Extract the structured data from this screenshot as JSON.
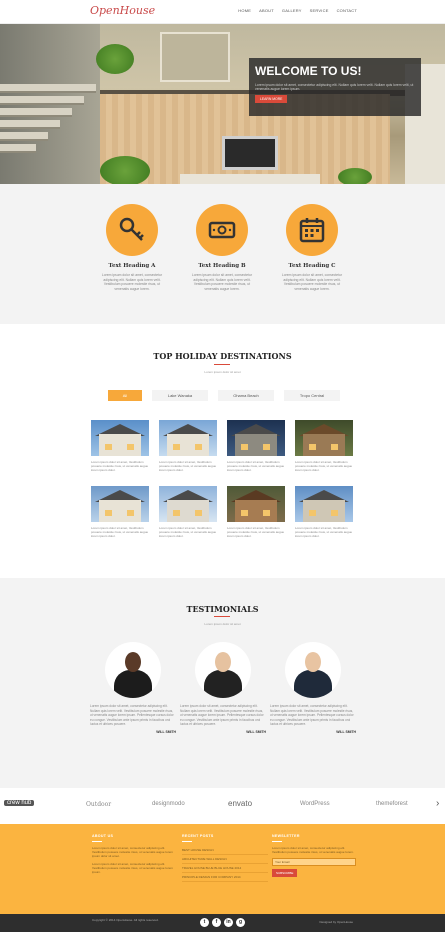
{
  "header": {
    "logo": "OpenHouse",
    "nav": [
      "HOME",
      "ABOUT",
      "GALLERY",
      "SERVICE",
      "CONTACT"
    ]
  },
  "hero": {
    "title": "WELCOME TO US!",
    "text": "Lorem ipsum dolor sit amet, consectetur adipiscing elit. Nullam quis lorem velit. Nullam quis lorem velit, ut venenatis augue lorem ipsum.",
    "button": "LEARN MORE"
  },
  "features": [
    {
      "icon": "key-icon",
      "title": "Text Heading A",
      "text": "Lorem ipsum dolor sit amet, consectetur adipiscing elit. Nullam quis lorem velit. Vestibulum posuere molestie risus, ut venenatis augue lorem."
    },
    {
      "icon": "money-icon",
      "title": "Text Heading B",
      "text": "Lorem ipsum dolor sit amet, consectetur adipiscing elit. Nullam quis lorem velit. Vestibulum posuere molestie risus, ut venenatis augue lorem."
    },
    {
      "icon": "calendar-icon",
      "title": "Text Heading C",
      "text": "Lorem ipsum dolor sit amet, consectetur adipiscing elit. Nullam quis lorem velit. Vestibulum posuere molestie risus, ut venenatis augue lorem."
    }
  ],
  "destinations": {
    "title": "TOP HOLIDAY DESTINATIONS",
    "subtitle": "Lorem ipsum dolor sit amet",
    "filters": [
      "All",
      "Lake Wanaka",
      "Ohama Beach",
      "Tropo Central"
    ],
    "card_text": "Lorem ipsum dolor sit amet, Vestibulum posuere molestie risus, ut venenatis augue lorem ipsum dolor."
  },
  "testimonials": {
    "title": "TESTIMONIALS",
    "subtitle": "Lorem ipsum dolor sit amet",
    "items": [
      {
        "text": "Lorem ipsum dolor sit amet, consectetur adipiscing elit. Nullam quis lorem velit. Vestibulum posuere molestie risus, ut venenatis augue lorem ipsum. Pellentesque cursus dolor eu congue. Vestibulum ante ipsum primis in faucibus orci luctus et ultrices posuere.",
        "name": "WILL SMITH"
      },
      {
        "text": "Lorem ipsum dolor sit amet, consectetur adipiscing elit. Nullam quis lorem velit. Vestibulum posuere molestie risus, ut venenatis augue lorem ipsum. Pellentesque cursus dolor eu congue. Vestibulum ante ipsum primis in faucibus orci luctus et ultrices posuere.",
        "name": "WILL SMITH"
      },
      {
        "text": "Lorem ipsum dolor sit amet, consectetur adipiscing elit. Nullam quis lorem velit. Vestibulum posuere molestie risus, ut venenatis augue lorem ipsum. Pellentesque cursus dolor eu congue. Vestibulum ante ipsum primis in faucibus orci luctus et ultrices posuere.",
        "name": "WILL SMITH"
      }
    ]
  },
  "clients": [
    "crew hub",
    "Outdoor",
    "designmodo",
    "envato",
    "WordPress",
    "themeforest"
  ],
  "footer": {
    "col1": {
      "title": "ABOUT US",
      "text1": "Lorem ipsum dolor sit amet, consectetur adipiscing elit. Vestibulum posuere molestie risus, ut venenatis augue lorem ipsum dolor sit amet.",
      "text2": "Lorem ipsum dolor sit amet, consectetur adipiscing elit. Vestibulum posuere molestie risus, ut venenatis augue lorem ipsum."
    },
    "col2": {
      "title": "RECENT POSTS",
      "links": [
        "BEST HOUSE DESIGN",
        "ARCHITECTURE WALL DESIGN",
        "TRAVEL HOUSE BLUE BLUE HOUSE 2014",
        "PRINCIPLE DESIGN FOR COMPANY 2014"
      ]
    },
    "col3": {
      "title": "NEWSLETTER",
      "text": "Lorem ipsum dolor sit amet, consectetur adipiscing elit. Vestibulum posuere molestie risus, ut venenatis augue lorem.",
      "placeholder": "Your Email",
      "button": "SUBSCRIBE"
    }
  },
  "bottom": {
    "copyright": "Copyright © 2014 OpenHouse. All rights reserved.",
    "credit": "Designed by OpenHouse",
    "socials": [
      "t",
      "f",
      "in",
      "g"
    ]
  },
  "colors": {
    "accent": "#f7a83a",
    "footer": "#fbb440",
    "red": "#d94a3a",
    "dark": "#2e2e2e"
  }
}
